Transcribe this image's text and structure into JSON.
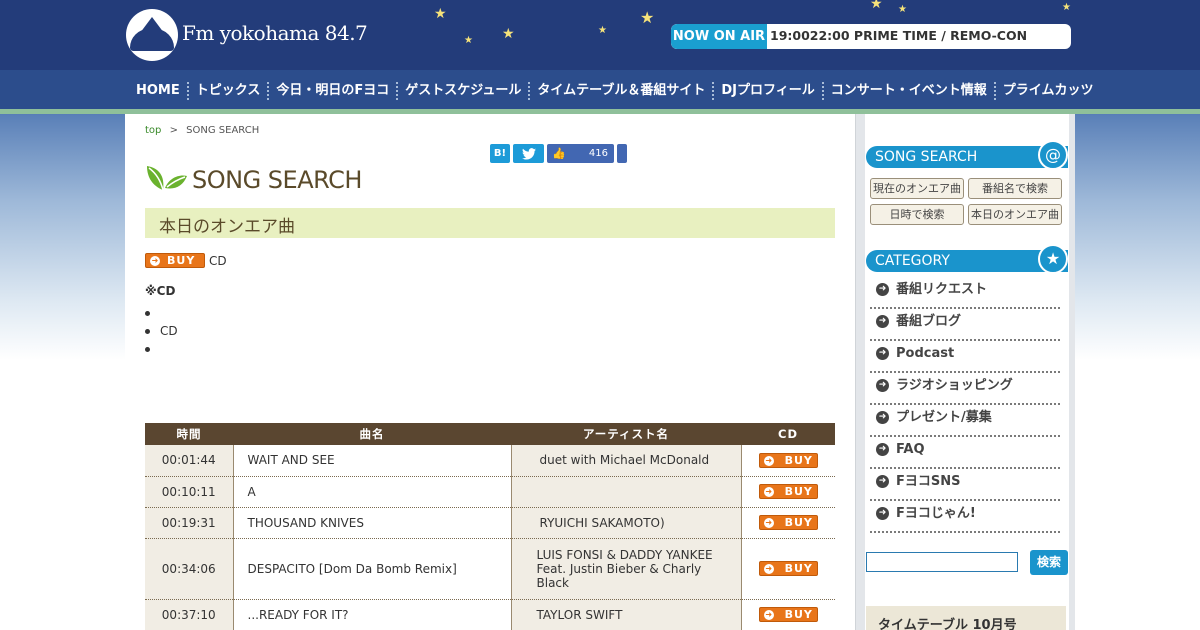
{
  "header": {
    "logo_text": "Fm yokohama 84.7",
    "onair_label": "NOW ON AIR",
    "onair_program": "19:0022:00  PRIME TIME   / REMO-CON"
  },
  "gnav": {
    "items": [
      "HOME",
      "トピックス",
      "今日・明日のFヨコ",
      "ゲストスケジュール",
      "タイムテーブル＆番組サイト",
      "DJプロフィール",
      "コンサート・イベント情報",
      "プライムカッツ"
    ]
  },
  "breadcrumb": {
    "top": "top",
    "sep": ">",
    "current": "SONG SEARCH"
  },
  "share": {
    "hatena": "B!",
    "twitter": "t",
    "like_count": "416"
  },
  "page_title": "SONG SEARCH",
  "section_title": "本日のオンエア曲",
  "buy_label": "BUY",
  "buy_row_text": "CD",
  "note_title": "※CD",
  "note_items": [
    "",
    "CD",
    ""
  ],
  "table": {
    "headers": [
      "時間",
      "曲名",
      "アーティスト名",
      "CD"
    ],
    "rows": [
      {
        "time": "00:01:44",
        "song": "WAIT AND SEE",
        "artist": " duet with Michael McDonald"
      },
      {
        "time": "00:10:11",
        "song": "A",
        "artist": ""
      },
      {
        "time": "00:19:31",
        "song": "THOUSAND KNIVES",
        "artist": " RYUICHI SAKAMOTO)"
      },
      {
        "time": "00:34:06",
        "song": "DESPACITO [Dom Da Bomb Remix]",
        "artist": "LUIS FONSI & DADDY YANKEE Feat. Justin Bieber & Charly Black"
      },
      {
        "time": "00:37:10",
        "song": "...READY FOR IT?",
        "artist": "TAYLOR SWIFT"
      }
    ]
  },
  "sidebar": {
    "song_search_title": "SONG SEARCH",
    "song_buttons": [
      "現在のオンエア曲",
      "番組名で検索",
      "日時で検索",
      "本日のオンエア曲"
    ],
    "category_title": "CATEGORY",
    "categories": [
      "番組リクエスト",
      "番組ブログ",
      "Podcast",
      "ラジオショッピング",
      "プレゼント/募集",
      "FAQ",
      "FヨコSNS",
      "Fヨコじゃん!"
    ],
    "search_button": "検索",
    "timetable_label": "タイムテーブル  10月号"
  },
  "colors": {
    "nav_blue": "#233c7a",
    "accent_blue": "#1a94cc",
    "buy_orange": "#e8751a",
    "table_head": "#5a4630",
    "section_bg": "#e8f0c0"
  }
}
